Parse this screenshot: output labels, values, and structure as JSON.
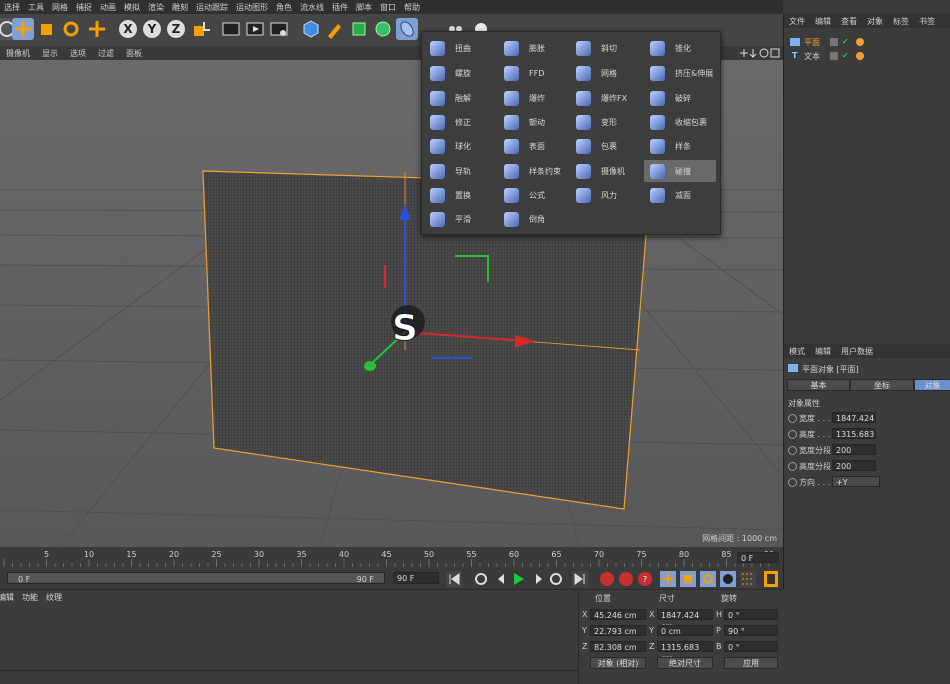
{
  "menu": [
    "选择",
    "工具",
    "网格",
    "捕捉",
    "动画",
    "模拟",
    "渲染",
    "雕刻",
    "运动跟踪",
    "运动图形",
    "角色",
    "流水线",
    "插件",
    "脚本",
    "窗口",
    "帮助"
  ],
  "toolbar_axes": [
    "X",
    "Y",
    "Z"
  ],
  "viewport_menu": [
    "摄像机",
    "显示",
    "选项",
    "过滤",
    "面板"
  ],
  "viewport_status": "网格间距 : 1000 cm",
  "deformers": [
    [
      "扭曲",
      "膨胀",
      "斜切",
      "锥化"
    ],
    [
      "螺旋",
      "FFD",
      "网格",
      "挤压&伸展"
    ],
    [
      "融解",
      "爆炸",
      "爆炸FX",
      "破碎"
    ],
    [
      "修正",
      "颤动",
      "变形",
      "收缩包裹"
    ],
    [
      "球化",
      "表面",
      "包裹",
      "样条"
    ],
    [
      "导轨",
      "样条约束",
      "摄像机",
      "碰撞"
    ],
    [
      "置换",
      "公式",
      "风力",
      "减面"
    ],
    [
      "平滑",
      "倒角",
      "",
      ""
    ]
  ],
  "deformer_selected": "碰撞",
  "object_manager": {
    "tabs": [
      "文件",
      "编辑",
      "查看",
      "对象",
      "标签",
      "书签"
    ],
    "objects": [
      "平面",
      "文本"
    ]
  },
  "attributes": {
    "tabs": [
      "模式",
      "编辑",
      "用户数据"
    ],
    "title": "平面对象 [平面]",
    "subtabs": [
      "基本",
      "坐标",
      "对象"
    ],
    "section": "对象属性",
    "fields": [
      {
        "label": "宽度 . . . .",
        "value": "1847.424"
      },
      {
        "label": "高度 . . . .",
        "value": "1315.683"
      },
      {
        "label": "宽度分段",
        "value": "200"
      },
      {
        "label": "高度分段",
        "value": "200"
      },
      {
        "label": "方向 . . . .",
        "value": "+Y"
      }
    ]
  },
  "timeline": {
    "ticks": [
      "5",
      "10",
      "15",
      "20",
      "25",
      "30",
      "35",
      "40",
      "45",
      "50",
      "55",
      "60",
      "65",
      "70",
      "75",
      "80",
      "85",
      "90"
    ],
    "current_frame": "0 F",
    "range_start": "0 F",
    "range_end": "90 F",
    "max_frame": "90 F"
  },
  "material_tabs": [
    "编辑",
    "功能",
    "纹理"
  ],
  "coordinates": {
    "headers": [
      "位置",
      "尺寸",
      "旋转"
    ],
    "rows": [
      {
        "axis": "X",
        "pos": "45.246 cm",
        "size_axis": "X",
        "size": "1847.424 cm",
        "rot_axis": "H",
        "rot": "0 °"
      },
      {
        "axis": "Y",
        "pos": "22.793 cm",
        "size_axis": "Y",
        "size": "0 cm",
        "rot_axis": "P",
        "rot": "90 °"
      },
      {
        "axis": "Z",
        "pos": "82.308 cm",
        "size_axis": "Z",
        "size": "1315.683 cm",
        "rot_axis": "B",
        "rot": "0 °"
      }
    ],
    "mode": "对象 (相对)",
    "size_mode": "绝对尺寸",
    "apply": "应用"
  },
  "colors": {
    "accent": "#7f9fd5",
    "selection": "#f0a030"
  }
}
